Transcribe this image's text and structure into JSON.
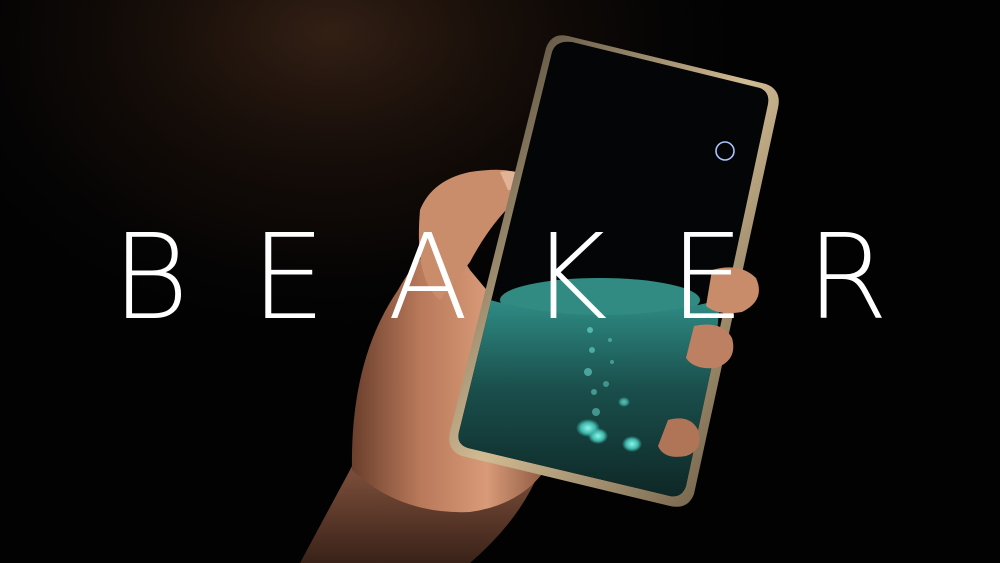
{
  "title": "BEAKER",
  "colors": {
    "background": "#050404",
    "title": "#ffffff",
    "liquid": "#1f6b66",
    "glow": "#5fe0d4",
    "ring": "#a9c4ff",
    "skin": "#c68b6a",
    "phone_frame": "#b8a07a"
  },
  "icons": {
    "ring": "circle-outline-icon"
  }
}
